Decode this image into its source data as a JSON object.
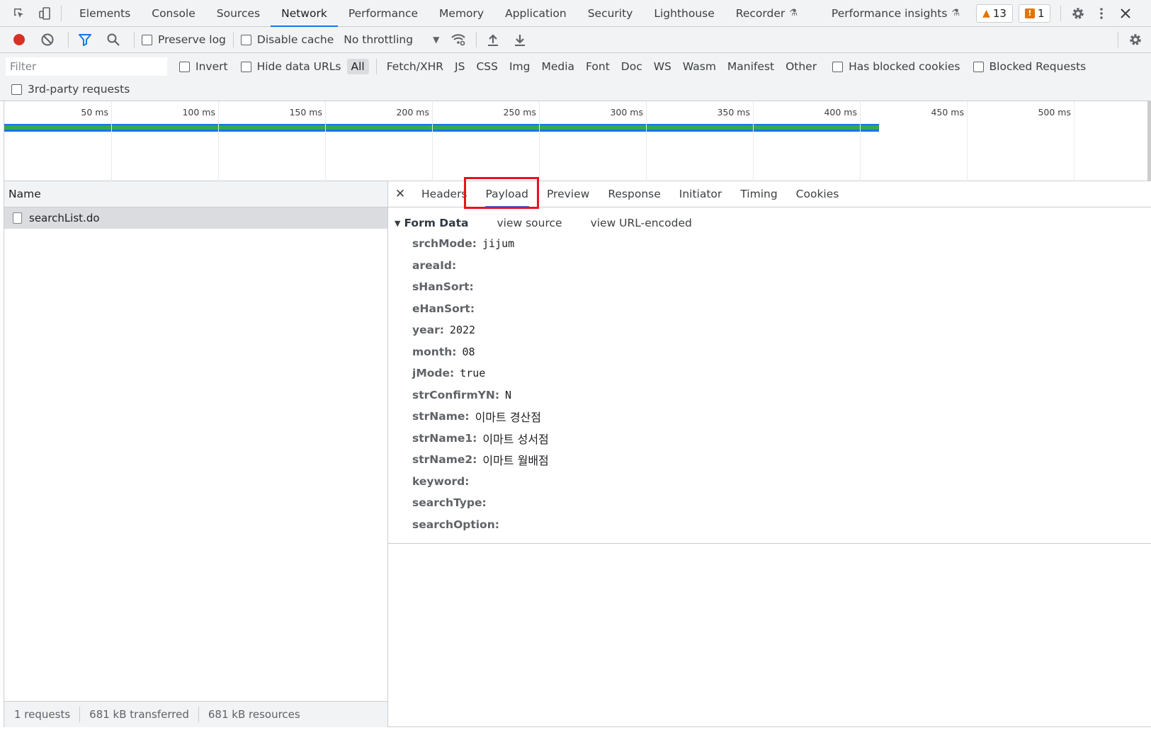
{
  "main_tabs": [
    {
      "label": "Elements"
    },
    {
      "label": "Console"
    },
    {
      "label": "Sources"
    },
    {
      "label": "Network"
    },
    {
      "label": "Performance"
    },
    {
      "label": "Memory"
    },
    {
      "label": "Application"
    },
    {
      "label": "Security"
    },
    {
      "label": "Lighthouse"
    },
    {
      "label": "Recorder"
    },
    {
      "label": "Performance insights"
    }
  ],
  "badges": {
    "warnings": "13",
    "issues": "1"
  },
  "toolbar": {
    "preserve_log": "Preserve log",
    "disable_cache": "Disable cache",
    "throttling": "No throttling"
  },
  "filter": {
    "placeholder": "Filter",
    "invert": "Invert",
    "hide_data_urls": "Hide data URLs",
    "types": [
      "All",
      "Fetch/XHR",
      "JS",
      "CSS",
      "Img",
      "Media",
      "Font",
      "Doc",
      "WS",
      "Wasm",
      "Manifest",
      "Other"
    ],
    "has_blocked_cookies": "Has blocked cookies",
    "blocked_requests": "Blocked Requests",
    "third_party": "3rd-party requests"
  },
  "timeline": {
    "ticks": [
      "50 ms",
      "100 ms",
      "150 ms",
      "200 ms",
      "250 ms",
      "300 ms",
      "350 ms",
      "400 ms",
      "450 ms",
      "500 ms"
    ],
    "bar_end_ms": 409
  },
  "request_list": {
    "header": "Name",
    "requests": [
      {
        "name": "searchList.do"
      }
    ]
  },
  "status": {
    "requests": "1 requests",
    "transferred": "681 kB transferred",
    "resources": "681 kB resources"
  },
  "detail": {
    "tabs": [
      "Headers",
      "Payload",
      "Preview",
      "Response",
      "Initiator",
      "Timing",
      "Cookies"
    ],
    "active_tab": "Payload",
    "section_title": "Form Data",
    "view_source": "view source",
    "view_url_encoded": "view URL-encoded",
    "form_data": [
      {
        "key": "srchMode:",
        "value": "jijum"
      },
      {
        "key": "areaId:",
        "value": ""
      },
      {
        "key": "sHanSort:",
        "value": ""
      },
      {
        "key": "eHanSort:",
        "value": ""
      },
      {
        "key": "year:",
        "value": "2022"
      },
      {
        "key": "month:",
        "value": "08"
      },
      {
        "key": "jMode:",
        "value": "true"
      },
      {
        "key": "strConfirmYN:",
        "value": "N"
      },
      {
        "key": "strName:",
        "value": "이마트 경산점"
      },
      {
        "key": "strName1:",
        "value": "이마트 성서점"
      },
      {
        "key": "strName2:",
        "value": "이마트 월배점"
      },
      {
        "key": "keyword:",
        "value": ""
      },
      {
        "key": "searchType:",
        "value": ""
      },
      {
        "key": "searchOption:",
        "value": ""
      }
    ]
  }
}
